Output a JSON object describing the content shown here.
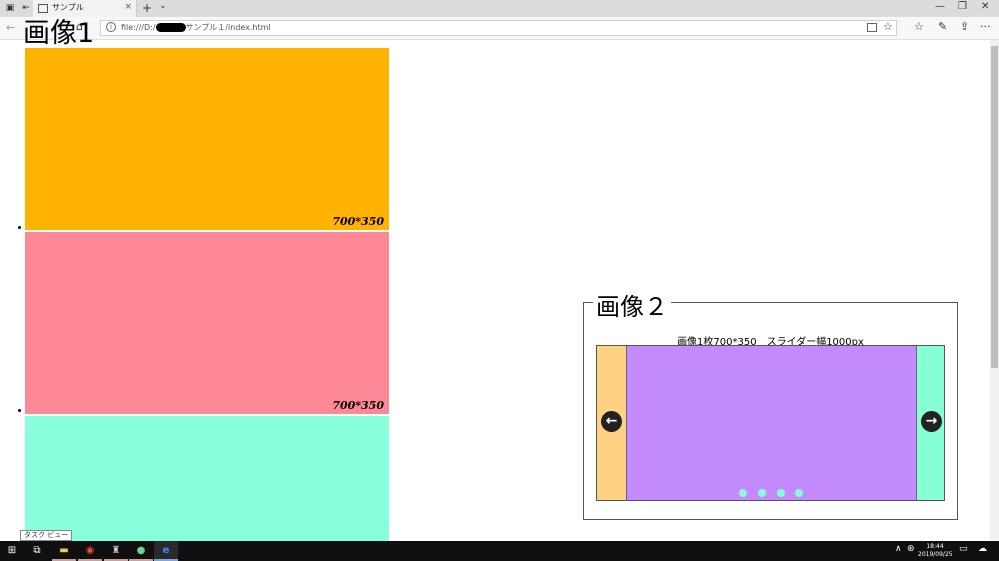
{
  "browser": {
    "tab_title": "サンプル",
    "tab_close": "×",
    "new_tab": "+",
    "tab_list": "⌄",
    "url_prefix": "file:///D:/",
    "url_suffix": "サンプル１/index.html",
    "minimize": "—",
    "restore": "❐",
    "close": "✕",
    "more": "···"
  },
  "page": {
    "title1": "画像1",
    "slide_label": "700*350",
    "slides": [
      {
        "color": "#ffb300",
        "label": "700*350"
      },
      {
        "color": "#ff8896",
        "label": "700*350"
      },
      {
        "color": "#87ffdd"
      }
    ],
    "title2": "画像２",
    "slider_caption": "画像1枚700*350　スライダー幅1000px",
    "slider_colors": {
      "left": "#ffd182",
      "center": "#c38bff",
      "right": "#87ffd6"
    },
    "prev_arrow": "←",
    "next_arrow": "→",
    "dot_count": 4
  },
  "tooltip": "タスク ビュー",
  "taskbar": {
    "clock_time": "18:44",
    "clock_date": "2019/09/25"
  }
}
